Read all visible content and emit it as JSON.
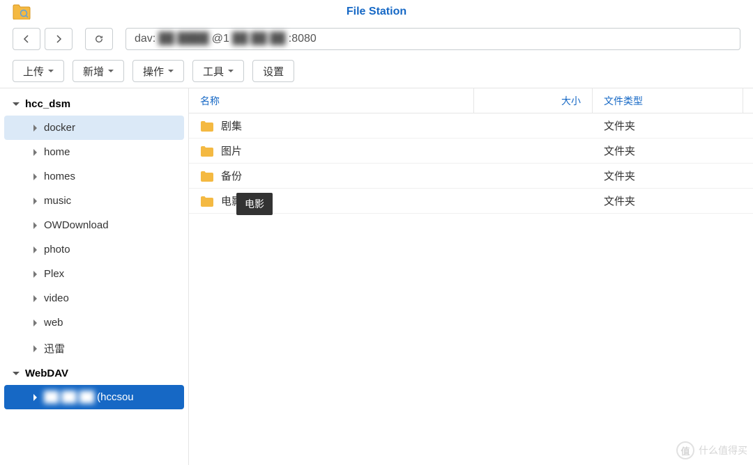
{
  "app": {
    "title": "File Station"
  },
  "address": {
    "prefix": "dav:",
    "hidden1": "██ ████",
    "at": "@1",
    "hidden2": "██ ██ ██",
    "port": ":8080"
  },
  "toolbar": {
    "upload": "上传",
    "new": "新增",
    "action": "操作",
    "tool": "工具",
    "settings": "设置"
  },
  "sidebar": {
    "root1": "hcc_dsm",
    "items1": [
      "docker",
      "home",
      "homes",
      "music",
      "OWDownload",
      "photo",
      "Plex",
      "video",
      "web",
      "迅雷"
    ],
    "root2": "WebDAV",
    "active_item_hidden": "██ ██ ██",
    "active_item_suffix": "(hccsou"
  },
  "columns": {
    "name": "名称",
    "size": "大小",
    "type": "文件类型"
  },
  "files": [
    {
      "name": "剧集",
      "type": "文件夹"
    },
    {
      "name": "图片",
      "type": "文件夹"
    },
    {
      "name": "备份",
      "type": "文件夹"
    },
    {
      "name": "电影",
      "type": "文件夹"
    }
  ],
  "tooltip": "电影",
  "watermark": {
    "icon": "值",
    "text": "什么值得买"
  }
}
